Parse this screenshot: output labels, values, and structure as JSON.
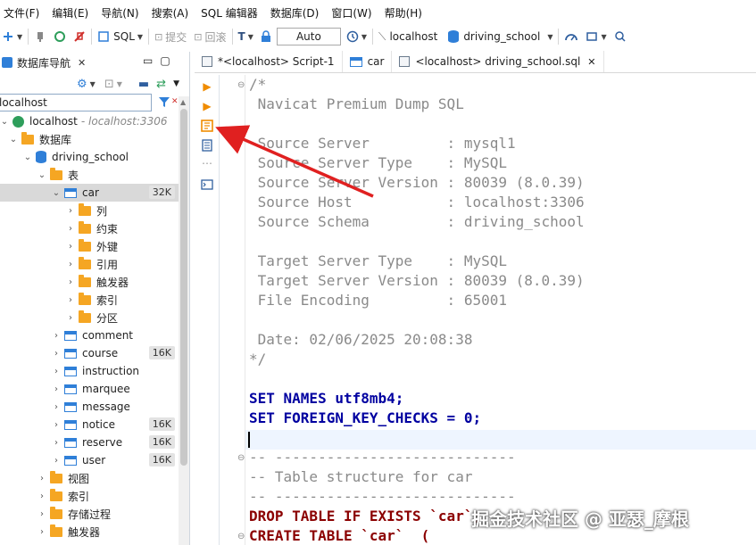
{
  "menu": [
    "文件(F)",
    "编辑(E)",
    "导航(N)",
    "搜索(A)",
    "SQL 编辑器",
    "数据库(D)",
    "窗口(W)",
    "帮助(H)"
  ],
  "toolbar": {
    "sql_label": "SQL",
    "commit_label": "提交",
    "rollback_label": "回滚",
    "mode_value": "Auto",
    "connection_label": "localhost",
    "database_label": "driving_school"
  },
  "navigator": {
    "tab_label": "数据库导航",
    "search_value": "localhost",
    "tree": [
      {
        "label": "localhost",
        "extra": " - localhost:3306",
        "depth": 0,
        "icon": "host-icon",
        "expanded": true
      },
      {
        "label": "数据库",
        "depth": 1,
        "icon": "folder-icon",
        "expanded": true
      },
      {
        "label": "driving_school",
        "depth": 2,
        "icon": "database-icon",
        "expanded": true
      },
      {
        "label": "表",
        "depth": 3,
        "icon": "folder-icon",
        "expanded": true
      },
      {
        "label": "car",
        "depth": 4,
        "icon": "table-icon",
        "expanded": true,
        "badge": "32K",
        "selected": true
      },
      {
        "label": "列",
        "depth": 5,
        "icon": "folder-icon"
      },
      {
        "label": "约束",
        "depth": 5,
        "icon": "folder-icon"
      },
      {
        "label": "外键",
        "depth": 5,
        "icon": "folder-icon"
      },
      {
        "label": "引用",
        "depth": 5,
        "icon": "folder-icon"
      },
      {
        "label": "触发器",
        "depth": 5,
        "icon": "folder-icon"
      },
      {
        "label": "索引",
        "depth": 5,
        "icon": "folder-icon"
      },
      {
        "label": "分区",
        "depth": 5,
        "icon": "folder-icon"
      },
      {
        "label": "comment",
        "depth": 4,
        "icon": "table-icon"
      },
      {
        "label": "course",
        "depth": 4,
        "icon": "table-icon",
        "badge": "16K"
      },
      {
        "label": "instruction",
        "depth": 4,
        "icon": "table-icon"
      },
      {
        "label": "marquee",
        "depth": 4,
        "icon": "table-icon"
      },
      {
        "label": "message",
        "depth": 4,
        "icon": "table-icon"
      },
      {
        "label": "notice",
        "depth": 4,
        "icon": "table-icon",
        "badge": "16K"
      },
      {
        "label": "reserve",
        "depth": 4,
        "icon": "table-icon",
        "badge": "16K"
      },
      {
        "label": "user",
        "depth": 4,
        "icon": "table-icon",
        "badge": "16K"
      },
      {
        "label": "视图",
        "depth": 3,
        "icon": "folder-icon"
      },
      {
        "label": "索引",
        "depth": 3,
        "icon": "folder-icon"
      },
      {
        "label": "存储过程",
        "depth": 3,
        "icon": "folder-icon"
      },
      {
        "label": "触发器",
        "depth": 3,
        "icon": "folder-icon"
      }
    ]
  },
  "editor_tabs": [
    {
      "label": "*<localhost> Script-1",
      "icon": "script-icon",
      "closable": false
    },
    {
      "label": "car",
      "icon": "table-icon",
      "closable": false
    },
    {
      "label": "<localhost> driving_school.sql",
      "icon": "script-icon",
      "closable": true,
      "active": true
    }
  ],
  "code_lines": [
    "/*",
    " Navicat Premium Dump SQL",
    "",
    " Source Server         : mysql1",
    " Source Server Type    : MySQL",
    " Source Server Version : 80039 (8.0.39)",
    " Source Host           : localhost:3306",
    " Source Schema         : driving_school",
    "",
    " Target Server Type    : MySQL",
    " Target Server Version : 80039 (8.0.39)",
    " File Encoding         : 65001",
    "",
    " Date: 02/06/2025 20:08:38",
    "*/",
    "",
    "SET NAMES utf8mb4;",
    "SET FOREIGN_KEY_CHECKS = 0;",
    "",
    "-- ----------------------------",
    "-- Table structure for car",
    "-- ----------------------------",
    "DROP TABLE IF EXISTS `car`;",
    "CREATE TABLE `car`  ("
  ],
  "watermark": "掘金技术社区 @ 亚瑟_摩根"
}
